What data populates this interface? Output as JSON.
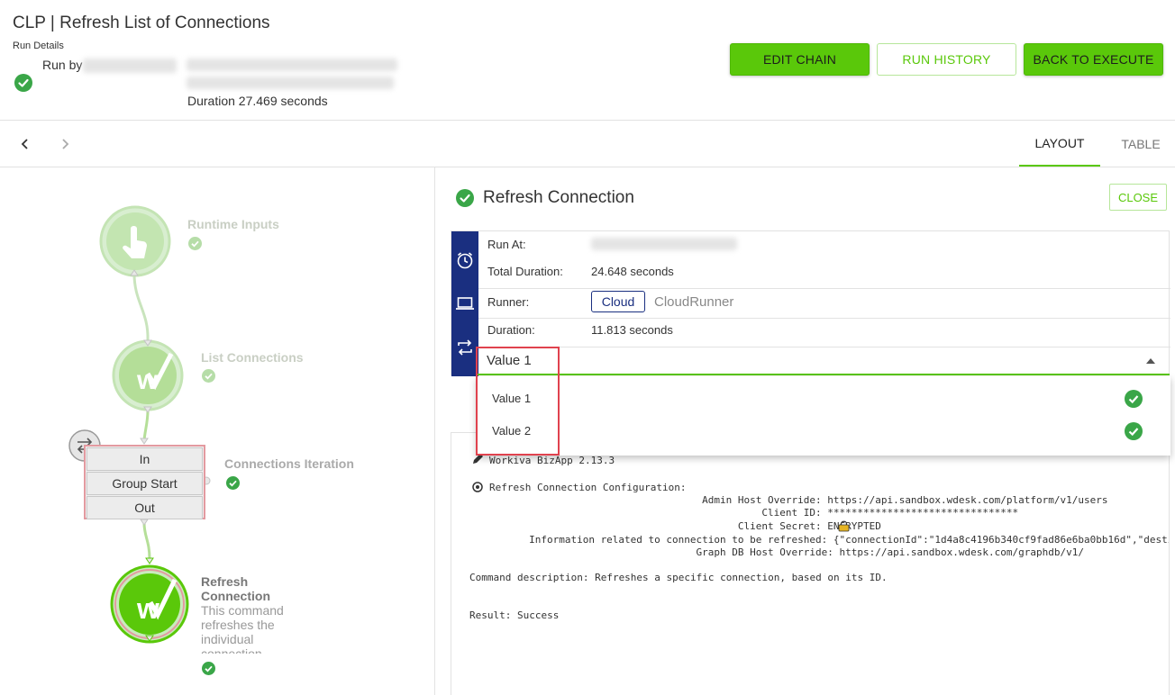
{
  "header": {
    "title": "CLP | Refresh List of Connections",
    "run_details_label": "Run Details",
    "run_by_label": "Run by",
    "duration": "Duration 27.469 seconds",
    "buttons": {
      "edit_chain": "EDIT CHAIN",
      "run_history": "RUN HISTORY",
      "back_to_execute": "BACK TO EXECUTE"
    }
  },
  "toolbar": {
    "prev_icon": "chevron-left",
    "next_icon": "chevron-right",
    "tabs": [
      {
        "label": "LAYOUT",
        "active": true
      },
      {
        "label": "TABLE",
        "active": false
      }
    ]
  },
  "canvas": {
    "nodes": {
      "runtime_inputs": "Runtime Inputs",
      "list_connections": "List Connections",
      "connections_iteration": "Connections Iteration",
      "refresh_connection_title_1": "Refresh",
      "refresh_connection_title_2": "Connection",
      "refresh_connection_desc": "This command refreshes the individual connection"
    },
    "group": {
      "in": "In",
      "group_start": "Group Start",
      "out": "Out"
    }
  },
  "panel": {
    "title": "Refresh Connection",
    "close": "CLOSE",
    "run_at_label": "Run At:",
    "total_duration_label": "Total Duration:",
    "total_duration": "24.648 seconds",
    "runner_label": "Runner:",
    "runner_badge": "Cloud",
    "runner_name": "CloudRunner",
    "duration_label": "Duration:",
    "duration": "11.813 seconds",
    "select_value": "Value 1",
    "dropdown_options": [
      "Value 1",
      "Value 2"
    ]
  },
  "log": {
    "line1": "Workiva BizApp 2.13.3",
    "line2": "Refresh Connection Configuration:",
    "line3": "                                          Admin Host Override: https://api.sandbox.wdesk.com/platform/v1/users",
    "line4": "                                                    Client ID: ********************************",
    "line5": "                                                Client Secret: ENCRYPTED",
    "line6": "             Information related to connection to be refreshed: {\"connectionId\":\"1d4a8c4196b340cf9fad86e6ba0bb16d\",\"destinati",
    "line7": "                                         Graph DB Host Override: https://api.sandbox.wdesk.com/graphdb/v1/",
    "line8": "Command description: Refreshes a specific connection, based on its ID.",
    "line9": "Result: Success"
  },
  "colors": {
    "accent": "#5ac80a",
    "navy": "#1a2f80",
    "success": "#3aa648",
    "highlight": "#e0424e"
  }
}
